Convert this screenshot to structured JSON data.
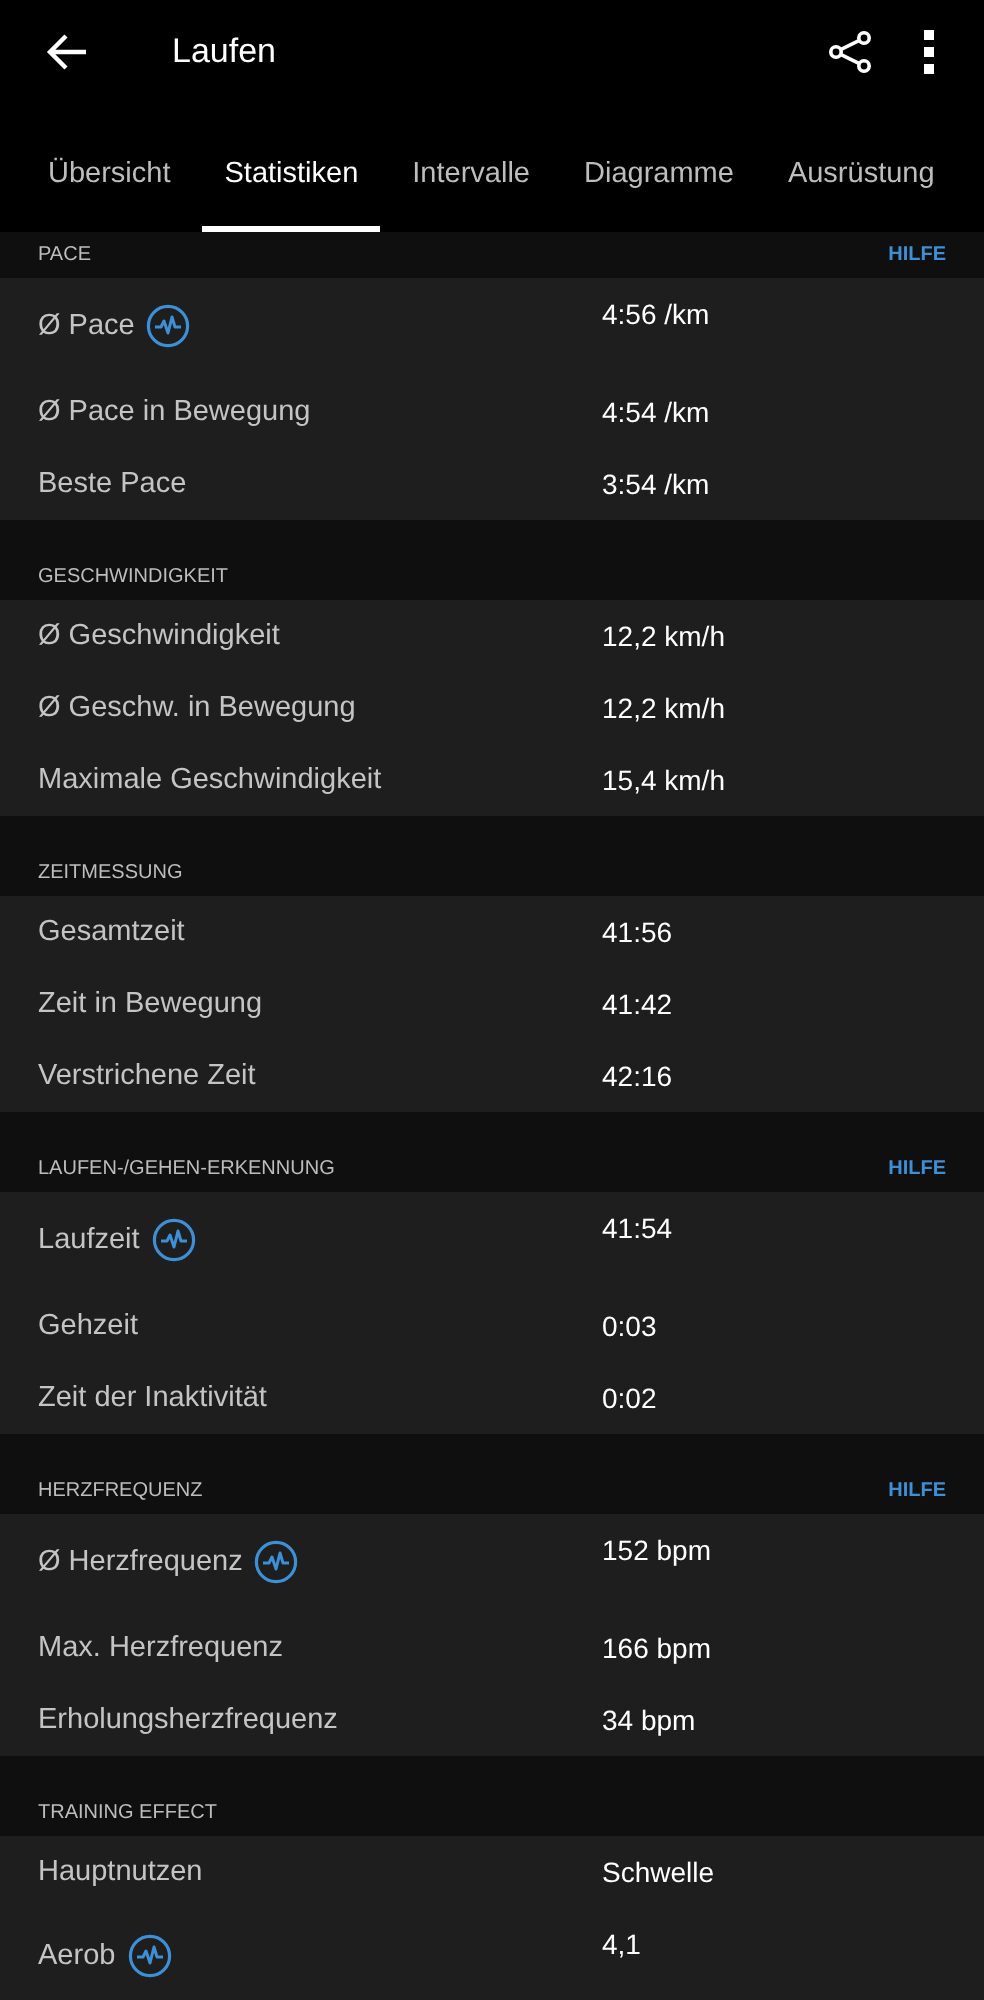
{
  "app_bar": {
    "title": "Laufen"
  },
  "tabs": [
    {
      "label": "Übersicht",
      "selected": false
    },
    {
      "label": "Statistiken",
      "selected": true
    },
    {
      "label": "Intervalle",
      "selected": false
    },
    {
      "label": "Diagramme",
      "selected": false
    },
    {
      "label": "Ausrüstung",
      "selected": false
    }
  ],
  "sections": [
    {
      "title": "PACE",
      "help": "HILFE",
      "rows": [
        {
          "label": "Ø Pace",
          "value": "4:56 /km",
          "chart_icon": true
        },
        {
          "label": "Ø Pace in Bewegung",
          "value": "4:54 /km",
          "chart_icon": false
        },
        {
          "label": "Beste Pace",
          "value": "3:54 /km",
          "chart_icon": false
        }
      ]
    },
    {
      "title": "GESCHWINDIGKEIT",
      "rows": [
        {
          "label": "Ø Geschwindigkeit",
          "value": "12,2 km/h",
          "chart_icon": false
        },
        {
          "label": "Ø Geschw. in Bewegung",
          "value": "12,2 km/h",
          "chart_icon": false
        },
        {
          "label": "Maximale Geschwindigkeit",
          "value": "15,4 km/h",
          "chart_icon": false
        }
      ]
    },
    {
      "title": "ZEITMESSUNG",
      "rows": [
        {
          "label": "Gesamtzeit",
          "value": "41:56",
          "chart_icon": false
        },
        {
          "label": "Zeit in Bewegung",
          "value": "41:42",
          "chart_icon": false
        },
        {
          "label": "Verstrichene Zeit",
          "value": "42:16",
          "chart_icon": false
        }
      ]
    },
    {
      "title": "LAUFEN-/GEHEN-ERKENNUNG",
      "help": "HILFE",
      "rows": [
        {
          "label": "Laufzeit",
          "value": "41:54",
          "chart_icon": true
        },
        {
          "label": "Gehzeit",
          "value": "0:03",
          "chart_icon": false
        },
        {
          "label": "Zeit der Inaktivität",
          "value": "0:02",
          "chart_icon": false
        }
      ]
    },
    {
      "title": "HERZFREQUENZ",
      "help": "HILFE",
      "rows": [
        {
          "label": "Ø Herzfrequenz",
          "value": "152 bpm",
          "chart_icon": true
        },
        {
          "label": "Max. Herzfrequenz",
          "value": "166 bpm",
          "chart_icon": false
        },
        {
          "label": "Erholungsherzfrequenz",
          "value": "34 bpm",
          "chart_icon": false
        }
      ]
    },
    {
      "title": "TRAINING EFFECT",
      "rows": [
        {
          "label": "Hauptnutzen",
          "value": "Schwelle",
          "chart_icon": false
        },
        {
          "label": "Aerob",
          "value": "4,1",
          "chart_icon": true
        }
      ]
    }
  ]
}
